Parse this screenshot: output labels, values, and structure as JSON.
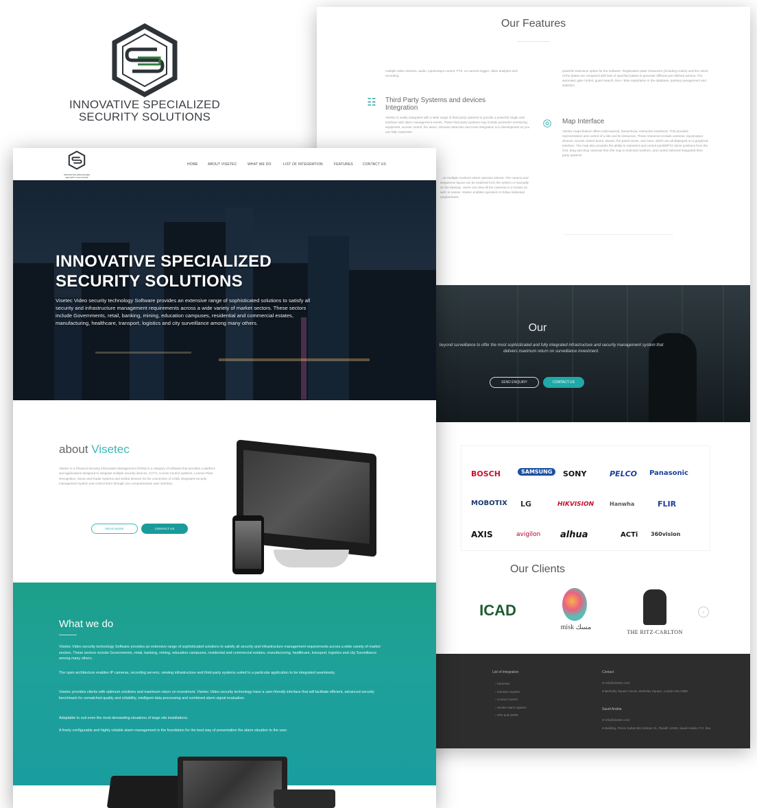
{
  "colors": {
    "accent": "#1fa9a9",
    "teal_section": "#1ea19a",
    "footer": "#2d2d2d",
    "nav_text": "#444444"
  },
  "brand": {
    "line1": "INNOVATIVE SPECIALIZED",
    "line2": "SECURITY SOLUTIONS",
    "icon": "shield-hexagon-logo-icon"
  },
  "features": {
    "title": "Our Features",
    "col_left_intro": "multiple video streams, audio, input/output control, PTZ, on-camera trigger, video analytics and recording.",
    "item_third_party": {
      "icon": "network-icon",
      "title": "Third Party Systems and devices Integration",
      "text": "Visetec is easily integrated with a wide range of third party systems to provide a powerful single user interface with alarm management events. These third party systems may include perimeter monitoring equipment, access control, fire alarm, intrusion detection and more integration is in development so you can fully customize."
    },
    "col_right_intro": "powerful extension option for the software. Registration plate characters (including Arabic) and the colors of the plates are compared with lists of specified plates to generate different pre-defined actions. The automatic gate control, guard search, time / date registration in the database, parking management and statistics.",
    "item_map": {
      "icon": "globe-icon",
      "title": "Map Interface",
      "text": "Visetec maps feature offers multi-layered, hierarchical, interactive interfaces. This provides representation and control of a site and its resources. These resources include cameras, input/output devices, access control doors, alarms, fire panel zones, and more, which are all displayed on a graphical interface. The map also provides the ability to represent and control pan/tilt/PTZ dome positions from the GUI, drag and drop cameras from the map to selected monitors, and control selected integrated third party systems."
    },
    "col_left_bottom": "...on multiple monitors where operator selects. The camera and sequences layout can be switched from the system or manually on the desktop. Users can view all the cameras in a mosaic as well, or review. Visetec enables operators to follow individual requirements."
  },
  "banner": {
    "title": "Our",
    "subtitle": "beyond surveillance to offer the most sophisticated and fully integrated infrastructure and security management system that delivers maximum return on surveillance investment.",
    "btn_enquiry": "SEND ENQUIRY",
    "btn_contact": "CONTACT US"
  },
  "partners": [
    "BOSCH",
    "SAMSUNG",
    "SONY",
    "PELCO",
    "Panasonic",
    "MOBOTIX",
    "LG",
    "HIKVISION",
    "Hanwha",
    "FLIR",
    "AXIS",
    "avigilon",
    "alhua",
    "ACTi",
    "360vision"
  ],
  "clients": {
    "title": "Our Clients",
    "items": [
      "ICAD",
      "misk مسك",
      "THE RITZ-CARLTON"
    ]
  },
  "footer": {
    "col1_title": "List of Integration",
    "col1_items": [
      "Cameras",
      "Intrusion System",
      "Access Control",
      "Smoke Alarm System",
      "LPR and ANPR"
    ],
    "col2_title": "Contact",
    "uk_email": "info@visetec.com",
    "uk_address": "Berkeley Square House, Berkeley Square, London W1J 6BD",
    "col3_title": "Saudi Arabia",
    "sa_email": "info@visetec.com",
    "sa_address": "Building, Prince Sultan Bin Salman St., Riyadh 12345, Saudi Arabia, P.O. Box"
  },
  "nav": {
    "items": [
      "HOME",
      "ABOUT VISETEC",
      "WHAT WE DO",
      "LIST OF INTEGRATION",
      "FEATURES",
      "CONTACT US"
    ],
    "logo_caption": "INNOVATIVE SPECIALIZED SECURITY SOLUTIONS"
  },
  "hero": {
    "title_line1": "INNOVATIVE SPECIALIZED",
    "title_line2": "SECURITY SOLUTIONS",
    "text": "Visetec Video security technology Software provides an extensive range of sophisticated solutions to satisfy all security and infrastructure management requirements across a wide variety of market sectors. These sectors include Governments, retail, banking, mining, education campuses, residential and commercial estates, manufacturing, healthcare, transport, logistics and city surveillance among many others."
  },
  "about": {
    "title_plain": "about ",
    "title_accent": "Visetec",
    "text": "Visetec is a Physical Security Information Management (PSIM) is a category of software that provides a platform and applications designed to integrate multiple security devices, CCTV, Access Control systems, License Plate Recognition, Sonar and Radar systems and similar devices for the connection of a fully integrated security management system and control them through one comprehensive user interface.",
    "read_more": "READ MORE",
    "contact": "CONTACT US"
  },
  "whatwedo": {
    "title": "What we do",
    "paragraphs": [
      "Visetec Video security technology Software provides an extensive range of sophisticated solutions to satisfy all security and infrastructure management requirements across a wide variety of market sectors. These sectors include Governments, retail, banking, mining, education campuses, residential and commercial estates, manufacturing, healthcare, transport, logistics and city Surveillance among many others.",
      "The open architecture enables IP cameras, recording servers, viewing infrastructure and third-party systems suited to a particular application to be integrated seamlessly.",
      "Visetec provides clients with optimum solutions and maximum return on investment. Visetec Video security technology have a user-friendly interface that will facilitate efficient, advanced security benchmark for unmatched quality and reliability, intelligent data processing and combined alarm signal evaluation.",
      "Adaptable to suit even the most demanding situations of large site installations.",
      "A freely configurable and highly reliable alarm management is the foundation for the best way of presentation the alarm situation to the user."
    ]
  }
}
